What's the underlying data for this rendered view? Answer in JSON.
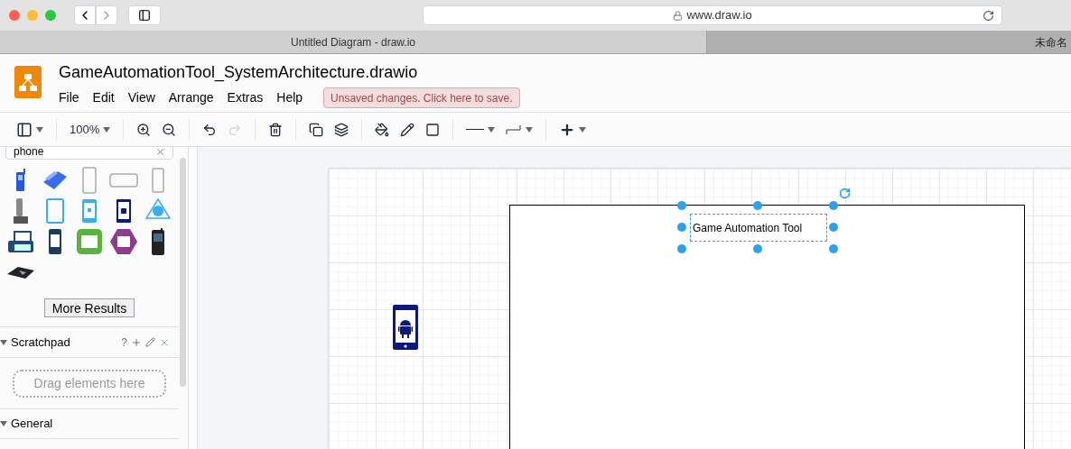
{
  "browser": {
    "url": "www.draw.io",
    "tabs": [
      {
        "title": "Untitled Diagram - draw.io",
        "selected": true
      },
      {
        "title": "未命名",
        "selected": false
      }
    ]
  },
  "app": {
    "file_title": "GameAutomationTool_SystemArchitecture.drawio",
    "menus": [
      "File",
      "Edit",
      "View",
      "Arrange",
      "Extras",
      "Help"
    ],
    "unsaved_notice": "Unsaved changes. Click here to save."
  },
  "toolbar": {
    "zoom": "100%"
  },
  "sidebar": {
    "search": {
      "value": "phone"
    },
    "more_results": "More Results",
    "scratchpad": {
      "title": "Scratchpad",
      "expanded": true,
      "help_glyph": "?",
      "drop_hint": "Drag elements here"
    },
    "general": {
      "title": "General",
      "expanded": true
    }
  },
  "canvas": {
    "label": "Game Automation Tool",
    "selected": true
  }
}
